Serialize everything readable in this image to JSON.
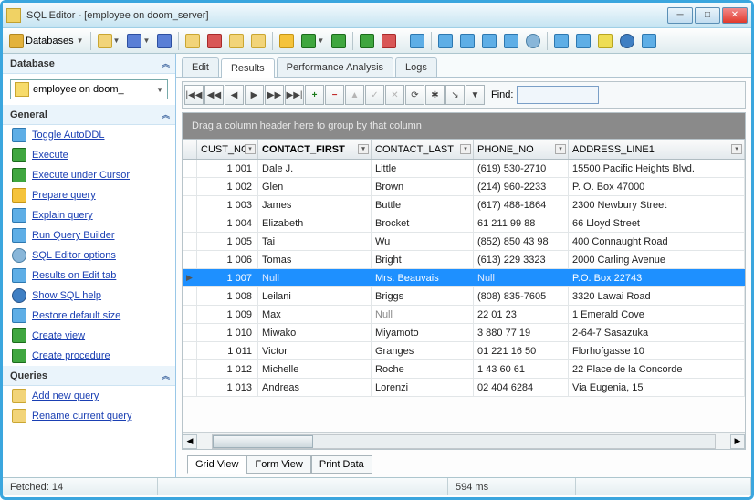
{
  "window": {
    "title": "SQL Editor - [employee on doom_server]"
  },
  "toolbar": {
    "databases": "Databases"
  },
  "side": {
    "database_title": "Database",
    "db_selected": "employee on doom_",
    "general_title": "General",
    "links": {
      "autoddl": "Toggle AutoDDL",
      "execute": "Execute",
      "exec_cursor": "Execute under Cursor",
      "prepare": "Prepare query",
      "explain": "Explain query",
      "qbuilder": "Run Query Builder",
      "options": "SQL Editor options",
      "edit_tab": "Results on Edit tab",
      "sql_help": "Show SQL help",
      "restore": "Restore default size",
      "create_view": "Create view",
      "create_proc": "Create procedure"
    },
    "queries_title": "Queries",
    "add_query": "Add new query",
    "rename_query": "Rename current query"
  },
  "tabs": {
    "edit": "Edit",
    "results": "Results",
    "perf": "Performance Analysis",
    "logs": "Logs"
  },
  "inner": {
    "find_label": "Find:"
  },
  "grouping_hint": "Drag a column header here to group by that column",
  "columns": {
    "c1": "CUST_NO",
    "c2": "CONTACT_FIRST",
    "c3": "CONTACT_LAST",
    "c4": "PHONE_NO",
    "c5": "ADDRESS_LINE1"
  },
  "rows": [
    {
      "n": "1 001",
      "f": "Dale J.",
      "l": "Little",
      "p": "(619) 530-2710",
      "a": "15500 Pacific Heights Blvd."
    },
    {
      "n": "1 002",
      "f": "Glen",
      "l": "Brown",
      "p": "(214) 960-2233",
      "a": "P. O. Box 47000"
    },
    {
      "n": "1 003",
      "f": "James",
      "l": "Buttle",
      "p": "(617) 488-1864",
      "a": "2300 Newbury Street"
    },
    {
      "n": "1 004",
      "f": "Elizabeth",
      "l": "Brocket",
      "p": "61 211 99 88",
      "a": "66 Lloyd Street"
    },
    {
      "n": "1 005",
      "f": "Tai",
      "l": "Wu",
      "p": "(852) 850 43 98",
      "a": "400 Connaught Road"
    },
    {
      "n": "1 006",
      "f": "Tomas",
      "l": "Bright",
      "p": "(613) 229 3323",
      "a": "2000 Carling Avenue"
    },
    {
      "n": "1 007",
      "f": "Null",
      "l": "Mrs. Beauvais",
      "p": "Null",
      "a": "P.O. Box 22743"
    },
    {
      "n": "1 008",
      "f": "Leilani",
      "l": "Briggs",
      "p": "(808) 835-7605",
      "a": "3320 Lawai Road"
    },
    {
      "n": "1 009",
      "f": "Max",
      "l": "Null",
      "p": "22 01 23",
      "a": "1 Emerald Cove"
    },
    {
      "n": "1 010",
      "f": "Miwako",
      "l": "Miyamoto",
      "p": "3 880 77 19",
      "a": "2-64-7 Sasazuka"
    },
    {
      "n": "1 011",
      "f": "Victor",
      "l": "Granges",
      "p": "01 221 16 50",
      "a": "Florhofgasse 10"
    },
    {
      "n": "1 012",
      "f": "Michelle",
      "l": "Roche",
      "p": "1 43 60 61",
      "a": "22 Place de la Concorde"
    },
    {
      "n": "1 013",
      "f": "Andreas",
      "l": "Lorenzi",
      "p": "02 404 6284",
      "a": "Via Eugenia, 15"
    }
  ],
  "viewtabs": {
    "grid": "Grid View",
    "form": "Form View",
    "print": "Print Data"
  },
  "status": {
    "fetched": "Fetched: 14",
    "time": "594 ms"
  }
}
